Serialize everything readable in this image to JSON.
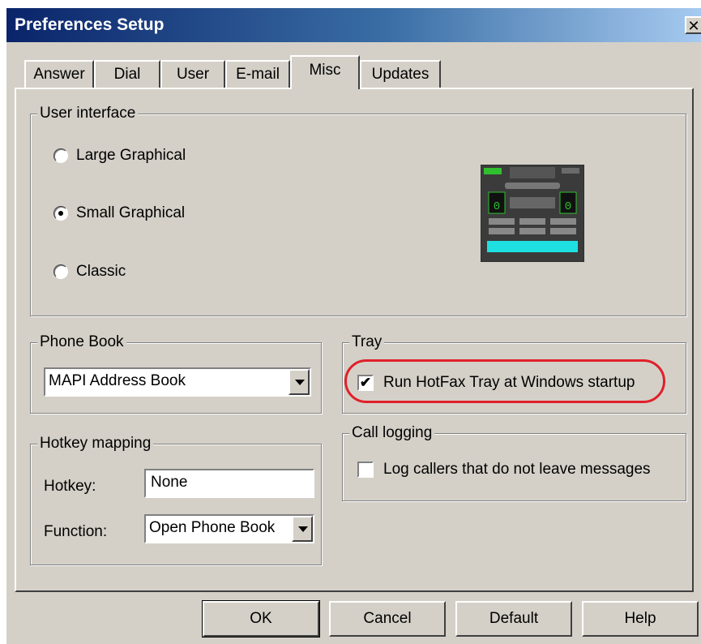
{
  "window": {
    "title": "Preferences Setup",
    "close_glyph": "✕"
  },
  "tabs": [
    {
      "label": "Answer",
      "active": false
    },
    {
      "label": "Dial",
      "active": false
    },
    {
      "label": "User",
      "active": false
    },
    {
      "label": "E-mail",
      "active": false
    },
    {
      "label": "Misc",
      "active": true
    },
    {
      "label": "Updates",
      "active": false
    }
  ],
  "user_interface": {
    "legend": "User interface",
    "options": [
      {
        "label": "Large Graphical",
        "selected": false
      },
      {
        "label": "Small Graphical",
        "selected": true
      },
      {
        "label": "Classic",
        "selected": false
      }
    ]
  },
  "phone_book": {
    "legend": "Phone Book",
    "selected": "MAPI Address Book"
  },
  "tray": {
    "legend": "Tray",
    "checkbox_label": "Run HotFax Tray at Windows startup",
    "checked": true,
    "highlight_color": "#e0202a"
  },
  "hotkey_mapping": {
    "legend": "Hotkey mapping",
    "hotkey_label": "Hotkey:",
    "hotkey_value": "None",
    "function_label": "Function:",
    "function_value": "Open Phone Book"
  },
  "call_logging": {
    "legend": "Call logging",
    "checkbox_label": "Log callers that do not leave messages",
    "checked": false
  },
  "buttons": {
    "ok": "OK",
    "cancel": "Cancel",
    "default": "Default",
    "help": "Help"
  },
  "colors": {
    "face": "#d4d0c8",
    "title_start": "#0a246a",
    "title_end": "#a6caf0"
  }
}
